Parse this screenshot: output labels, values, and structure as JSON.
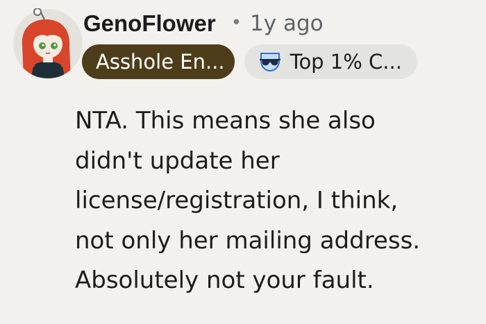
{
  "comment": {
    "author": "GenoFlower",
    "separator": "•",
    "timestamp": "1y ago",
    "user_flair": "Asshole En...",
    "achievement_flair": {
      "icon": "sunglasses-trophy-icon",
      "label": "Top 1% C..."
    },
    "body_lines": [
      "NTA. This means she also",
      "didn't update her",
      "license/registration, I think,",
      "not only her mailing address.",
      "Absolutely not your fault."
    ]
  },
  "colors": {
    "background": "#f2f1ed",
    "user_flair_bg": "#4e3d1a",
    "achievement_flair_bg": "#e3e3df",
    "avatar_bg": "#e4e2dc",
    "avatar_hair": "#d9452b"
  }
}
